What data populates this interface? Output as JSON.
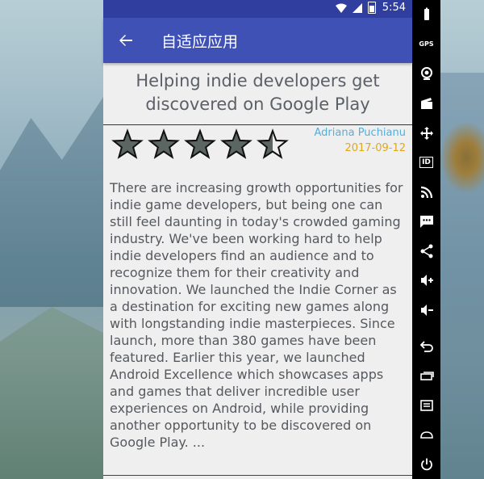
{
  "status_bar": {
    "time": "5:54",
    "icons": [
      "wifi-icon",
      "signal-icon",
      "battery-icon"
    ]
  },
  "app_bar": {
    "title": "自适应应用",
    "back_icon": "arrow-back-icon"
  },
  "article": {
    "title": "Helping indie developers get discovered on Google Play",
    "author": "Adriana Puchianu",
    "date": "2017-09-12",
    "rating": 4.5,
    "rating_max": 5,
    "body": "There are increasing growth opportunities for indie game developers, but being one can still feel daunting in today's crowded gaming industry. We've been working hard to help indie developers find an audience and to recognize them for their creativity and innovation. We launched the Indie Corner as a destination for exciting new games along with longstanding indie masterpieces. Since launch, more than 380 games have been featured. Earlier this year, we launched Android Excellence which showcases apps and games that deliver incredible user experiences on Android, while providing another opportunity to be discovered on Google Play. ..."
  },
  "emulator_toolbar": {
    "gps_label": "GPS",
    "id_label": "ID",
    "buttons": [
      "battery-icon",
      "gps-icon",
      "camera-icon",
      "video-icon",
      "move-icon",
      "id-icon",
      "rss-icon",
      "sms-icon",
      "share-icon",
      "volume-up-icon",
      "volume-down-icon",
      "back-icon",
      "recent-apps-icon",
      "menu-icon",
      "home-icon",
      "power-icon"
    ]
  },
  "colors": {
    "status_bar": "#303f9f",
    "app_bar": "#3f51b5",
    "author": "#4fb0e0",
    "date": "#e0a81c",
    "star_fill": "#5b6562"
  }
}
